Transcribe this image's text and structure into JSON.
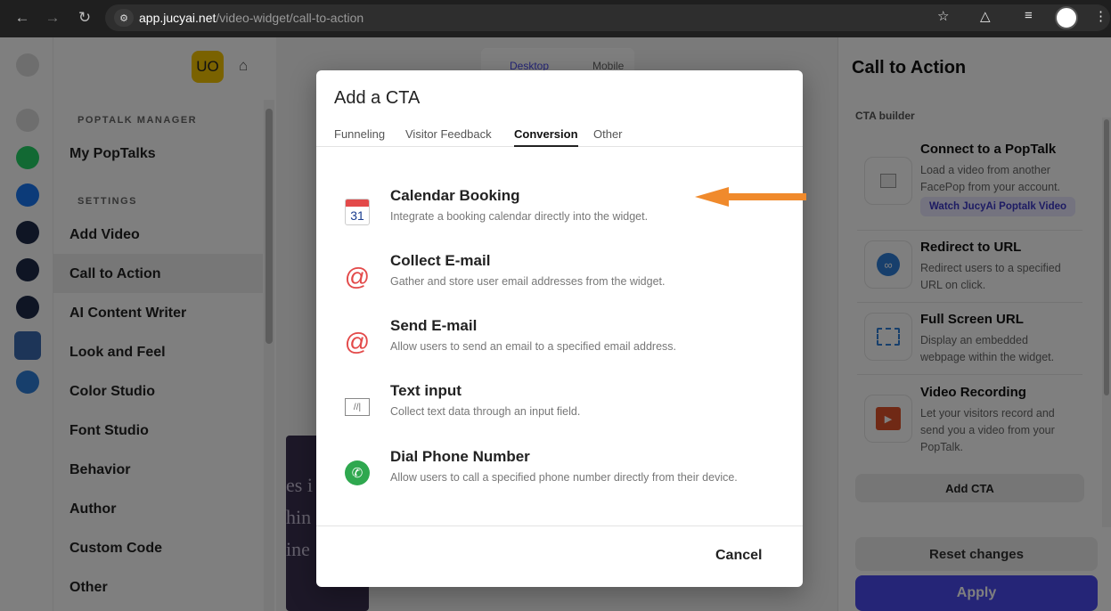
{
  "browser": {
    "url_host": "app.jucyai.net",
    "url_path": "/video-widget/call-to-action"
  },
  "header": {
    "avatar_initials": "UO"
  },
  "device_toggle": {
    "desktop": "Desktop",
    "mobile": "Mobile"
  },
  "menu": {
    "section_manager": "POPTALK MANAGER",
    "my_poptalks": "My PopTalks",
    "section_settings": "SETTINGS",
    "items": [
      "Add Video",
      "Call to Action",
      "AI Content Writer",
      "Look and Feel",
      "Color Studio",
      "Font Studio",
      "Behavior",
      "Author",
      "Custom Code",
      "Other"
    ]
  },
  "preview_text": [
    "es i",
    "hin",
    "ine"
  ],
  "right_panel": {
    "title": "Call to Action",
    "subtitle": "CTA builder",
    "cards": [
      {
        "title": "Connect to a PopTalk",
        "desc": "Load a video from another FacePop from your account.",
        "link": "Watch JucyAi Poptalk Video"
      },
      {
        "title": "Redirect to URL",
        "desc": "Redirect users to a specified URL on click."
      },
      {
        "title": "Full Screen URL",
        "desc": "Display an embedded webpage within the widget."
      },
      {
        "title": "Video Recording",
        "desc": "Let your visitors record and send you a video from your PopTalk."
      }
    ],
    "add_cta": "Add CTA",
    "reset": "Reset changes",
    "apply": "Apply"
  },
  "modal": {
    "title": "Add a CTA",
    "tabs": [
      "Funneling",
      "Visitor Feedback",
      "Conversion",
      "Other"
    ],
    "active_tab": "Conversion",
    "options": [
      {
        "title": "Calendar Booking",
        "desc": "Integrate a booking calendar directly into the widget.",
        "icon": "calendar-icon",
        "icon_text": "31"
      },
      {
        "title": "Collect E-mail",
        "desc": "Gather and store user email addresses from the widget.",
        "icon": "at-sign-icon"
      },
      {
        "title": "Send E-mail",
        "desc": "Allow users to send an email to a specified email address.",
        "icon": "at-sign-icon"
      },
      {
        "title": "Text input",
        "desc": "Collect text data through an input field.",
        "icon": "text-input-icon"
      },
      {
        "title": "Dial Phone Number",
        "desc": "Allow users to call a specified phone number directly from their device.",
        "icon": "phone-icon"
      }
    ],
    "cancel": "Cancel"
  },
  "colors": {
    "accent_purple": "#4a4aee",
    "arrow_orange": "#f08a2c",
    "avatar_yellow": "#f5c400",
    "at_red": "#e34a4a",
    "phone_green": "#2fa84f"
  }
}
